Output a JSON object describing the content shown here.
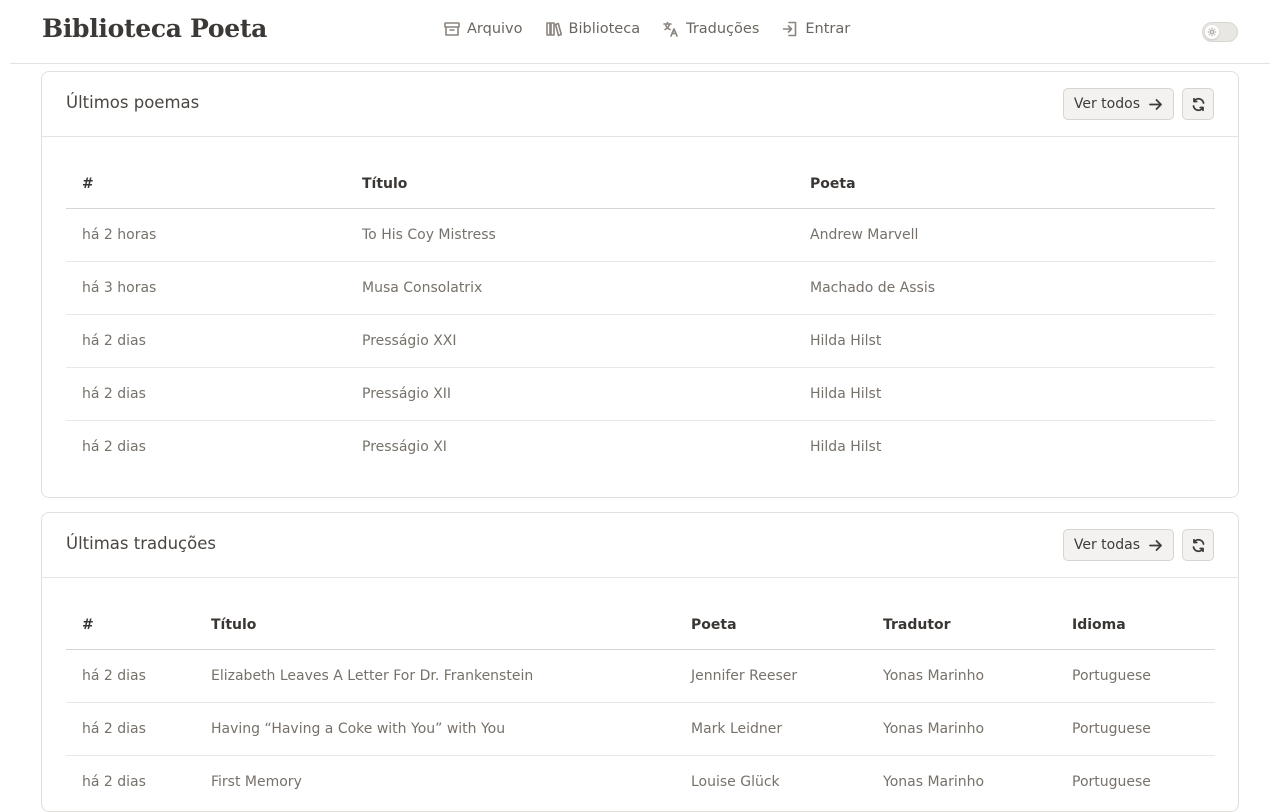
{
  "header": {
    "brand": "Biblioteca Poeta",
    "nav": [
      {
        "label": "Arquivo",
        "icon": "archive-icon"
      },
      {
        "label": "Biblioteca",
        "icon": "library-icon"
      },
      {
        "label": "Traduções",
        "icon": "languages-icon"
      },
      {
        "label": "Entrar",
        "icon": "login-icon"
      }
    ],
    "theme_toggle_icon": "sun-icon"
  },
  "poems": {
    "title": "Últimos poemas",
    "view_all_label": "Ver todos",
    "columns": [
      "#",
      "Título",
      "Poeta"
    ],
    "rows": [
      [
        "há 2 horas",
        "To His Coy Mistress",
        "Andrew Marvell"
      ],
      [
        "há 3 horas",
        "Musa Consolatrix",
        "Machado de Assis"
      ],
      [
        "há 2 dias",
        "Presságio XXI",
        "Hilda Hilst"
      ],
      [
        "há 2 dias",
        "Presságio XII",
        "Hilda Hilst"
      ],
      [
        "há 2 dias",
        "Presságio XI",
        "Hilda Hilst"
      ]
    ]
  },
  "translations": {
    "title": "Últimas traduções",
    "view_all_label": "Ver todas",
    "columns": [
      "#",
      "Título",
      "Poeta",
      "Tradutor",
      "Idioma"
    ],
    "rows": [
      [
        "há 2 dias",
        "Elizabeth Leaves A Letter For Dr. Frankenstein",
        "Jennifer Reeser",
        "Yonas Marinho",
        "Portuguese"
      ],
      [
        "há 2 dias",
        "Having “Having a Coke with You” with You",
        "Mark Leidner",
        "Yonas Marinho",
        "Portuguese"
      ],
      [
        "há 2 dias",
        "First Memory",
        "Louise Glück",
        "Yonas Marinho",
        "Portuguese"
      ]
    ]
  }
}
